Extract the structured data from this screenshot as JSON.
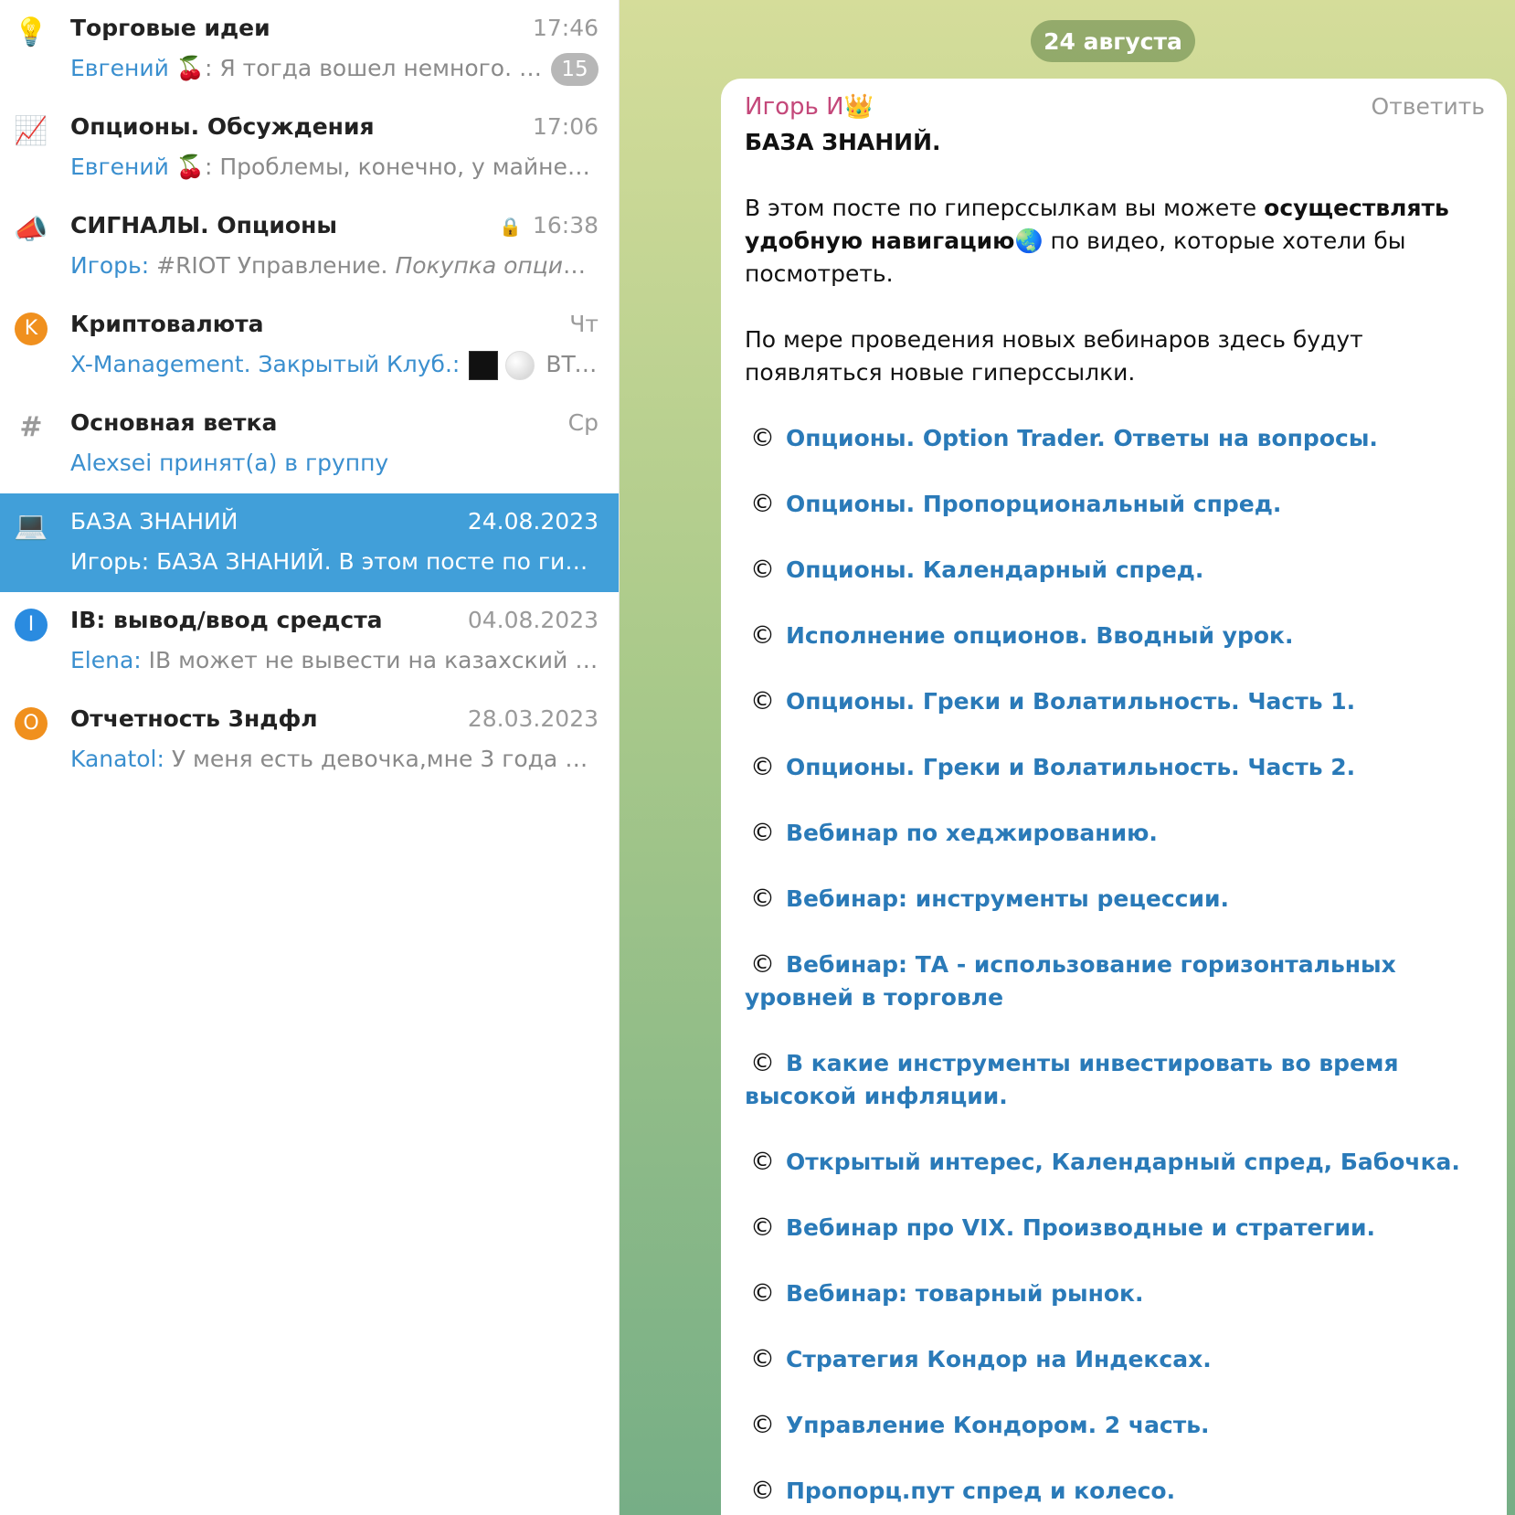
{
  "chats": [
    {
      "icon": "💡",
      "title": "Торговые идеи",
      "time": "17:46",
      "sender": "Евгений 🍒",
      "preview": ": Я тогда вошел немного. У...",
      "badge": "15"
    },
    {
      "icon": "📈",
      "title": "Опционы. Обсуждения",
      "time": "17:06",
      "sender": "Евгений 🍒",
      "preview": ": Проблемы, конечно, у майнер..."
    },
    {
      "icon": "📣",
      "title": "СИГНАЛЫ. Опционы",
      "time": "16:38",
      "sender": "Игорь:",
      "preview": " #RIOT Управление. ",
      "preview_italic": "Покупка опцион..."
    },
    {
      "icon": "K",
      "title": "Криптовалюта",
      "time": "Чт",
      "sender": "X-Management. Закрытый Клуб.:",
      "preview": "BTC..."
    },
    {
      "icon": "#",
      "title": "Основная ветка",
      "time": "Ср",
      "sender": "Alexsei принят(а) в группу",
      "preview": ""
    },
    {
      "icon": "💻",
      "title": "БАЗА ЗНАНИЙ",
      "time": "24.08.2023",
      "sender": "Игорь:",
      "preview": " БАЗА ЗНАНИЙ.  В этом посте по гипе..."
    },
    {
      "icon": "I",
      "title": "IB: вывод/ввод средста",
      "time": "04.08.2023",
      "sender": "Elena:",
      "preview": " IB может не вывести на казахский фр..."
    },
    {
      "icon": "O",
      "title": "Отчетность 3ндфл",
      "time": "28.03.2023",
      "sender": "Kanatol:",
      "preview": " У меня есть девочка,мне 3 года счи..."
    }
  ],
  "date_pill": "24 августа",
  "message": {
    "author": "Игорь И",
    "author_emoji": "👑",
    "reply": "Ответить",
    "title": "БАЗА ЗНАНИЙ.",
    "para1_a": "В этом посте по гиперссылкам вы можете ",
    "para1_bold": "осуществлять удобную навигацию",
    "para1_emoji": "🌏",
    "para1_b": " по видео, которые хотели бы посмотреть.",
    "para2": "По мере проведения новых вебинаров здесь будут появляться новые гиперссылки.",
    "copy_symbol": "©",
    "links": [
      "Опционы. Option Trader. Ответы на вопросы.",
      "Опционы. Пропорциональный спред.",
      "Опционы. Календарный спред.",
      "Исполнение опционов. Вводный урок.",
      "Опционы. Греки и Волатильность. Часть 1.",
      "Опционы. Греки и Волатильность. Часть 2.",
      "Вебинар по хеджированию.",
      "Вебинар: инструменты рецессии.",
      "Вебинар: ТА - использование горизонтальных уровней в торговле",
      "В какие инструменты инвестировать во время высокой инфляции.",
      "Открытый интерес, Календарный спред, Бабочка.",
      "Вебинар про VIX. Производные и стратегии.",
      "Вебинар: товарный рынок.",
      "Стратегия Кондор на Индексах.",
      "Управление Кондором. 2 часть.",
      "Пропорц.пут спред и колесо."
    ]
  },
  "colors": {
    "accent": "#419fd9",
    "link": "#2a7ab8",
    "author": "#c4487a"
  }
}
